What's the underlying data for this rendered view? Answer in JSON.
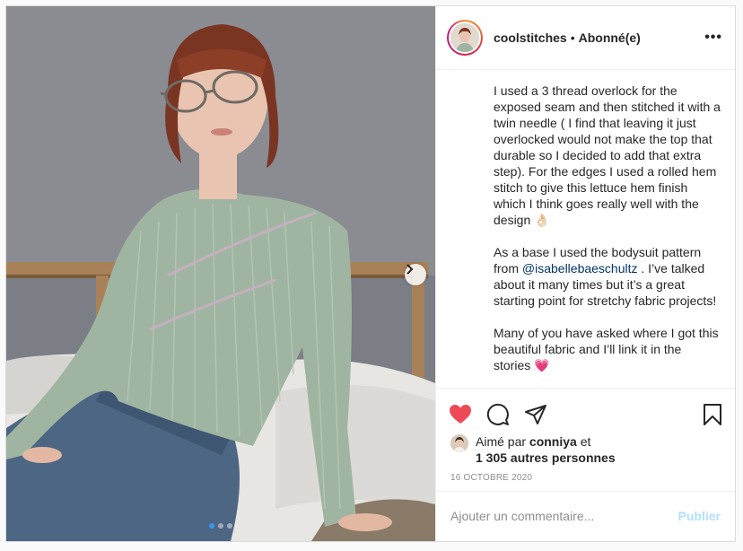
{
  "header": {
    "username": "coolstitches",
    "bullet": "•",
    "follow_status": "Abonné(e)",
    "more_icon": "more-horizontal-icon",
    "more_label": "•••"
  },
  "caption": {
    "paragraph1": "I used a 3 thread overlock for the exposed seam and then stitched it with a twin needle ( I find that leaving it just overlocked would not make the top that durable so I decided to add that extra step). For the edges I used a rolled hem stitch to give this lettuce hem finish which I think goes really well with the design 👌🏻",
    "paragraph2_before": "As a base I used the bodysuit pattern from ",
    "paragraph2_mention": "@isabellebaeschultz",
    "paragraph2_after": " . I’ve talked about it many times but it’s a great starting point for stretchy fabric projects!",
    "paragraph3": "Many of you have asked where I got this beautiful fabric and I’ll link it in the stories 💗"
  },
  "actions": {
    "like_icon": "heart-filled-icon",
    "comment_icon": "comment-icon",
    "share_icon": "paper-plane-icon",
    "save_icon": "bookmark-icon",
    "like_color": "#ed4956"
  },
  "likes": {
    "prefix": "Aimé par ",
    "user": "conniya",
    "conjunction": " et",
    "others": "1 305 autres personnes"
  },
  "date": "16 OCTOBRE 2020",
  "comment": {
    "placeholder": "Ajouter un commentaire...",
    "publish_label": "Publier"
  },
  "carousel": {
    "current_index": 1,
    "total": 3,
    "next_icon": "chevron-right-icon",
    "active_color": "#3897f0"
  }
}
